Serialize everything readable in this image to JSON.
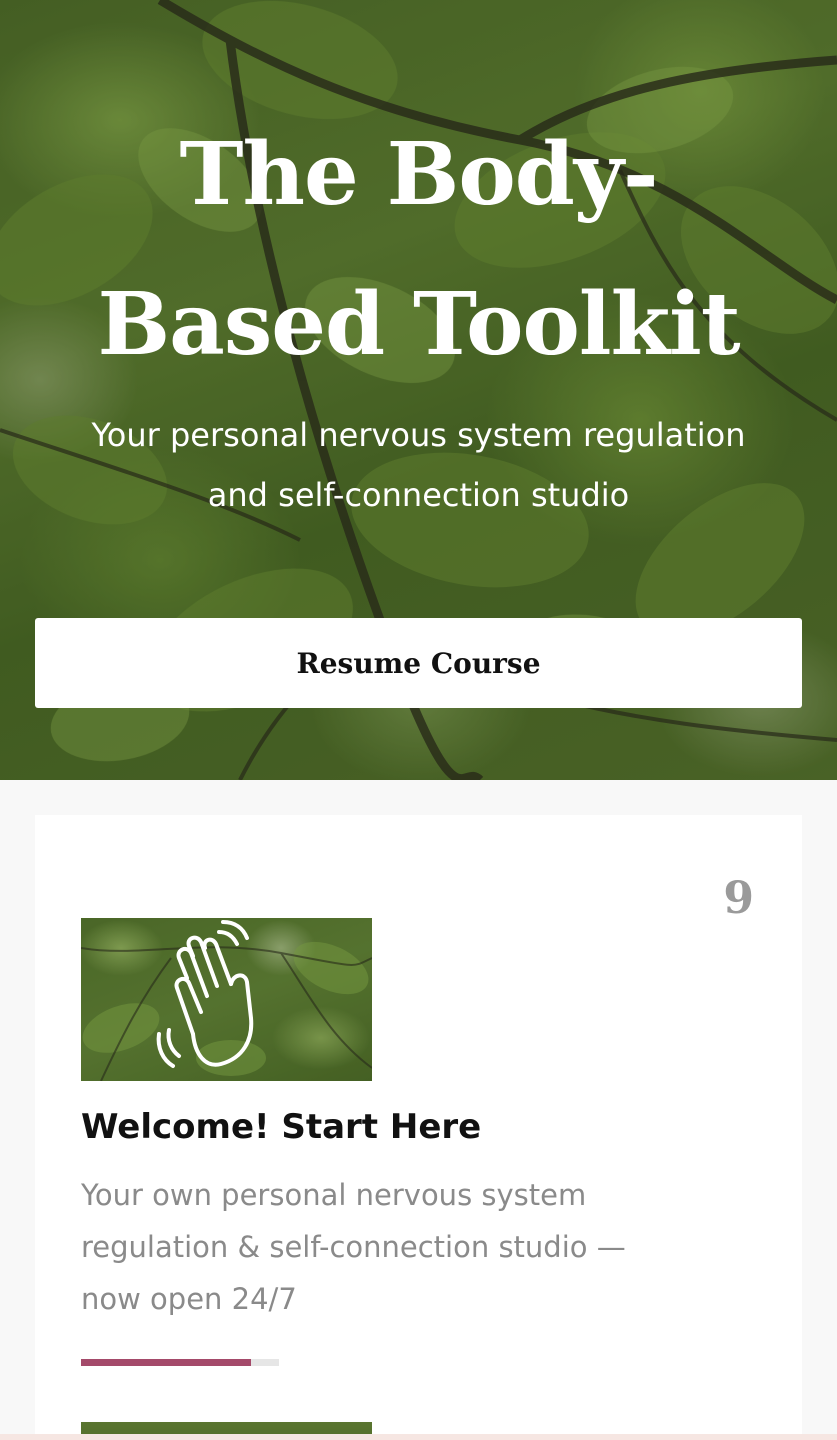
{
  "hero": {
    "title_line1": "The Body-",
    "title_line2": "Based Toolkit",
    "subtitle_line1": "Your personal nervous system regulation",
    "subtitle_line2": "and self-connection studio",
    "resume_label": "Resume Course"
  },
  "card": {
    "count": "9",
    "thumbnail_icon": "waving-hand-icon",
    "title": "Welcome! Start Here",
    "description_line1": "Your own personal nervous system",
    "description_line2": "regulation & self-connection studio —",
    "description_line3": "now open 24/7",
    "progress_fraction": 0.86,
    "progress_color": "#a44a6a"
  },
  "colors": {
    "accent": "#a44a6a",
    "background": "#f8f8f8"
  }
}
